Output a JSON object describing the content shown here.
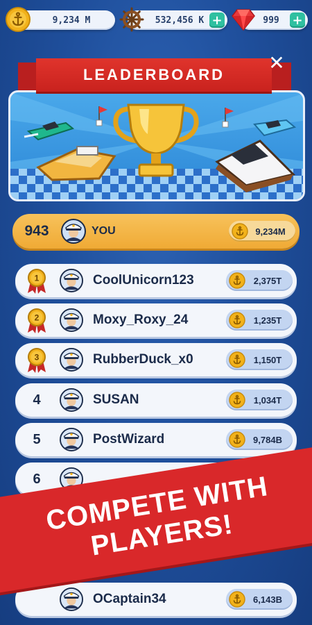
{
  "topbar": {
    "coins": "9,234 M",
    "helm": "532,456 K",
    "gems": "999"
  },
  "banner": {
    "title": "LEADERBOARD"
  },
  "you_row": {
    "rank": "943",
    "name": "YOU",
    "score": "9,234M"
  },
  "rows": [
    {
      "rank": "1",
      "name": "CoolUnicorn123",
      "score": "2,375T",
      "medal": true
    },
    {
      "rank": "2",
      "name": "Moxy_Roxy_24",
      "score": "1,235T",
      "medal": true
    },
    {
      "rank": "3",
      "name": "RubberDuck_x0",
      "score": "1,150T",
      "medal": true
    },
    {
      "rank": "4",
      "name": "SUSAN",
      "score": "1,034T",
      "medal": false
    },
    {
      "rank": "5",
      "name": "PostWizard",
      "score": "9,784B",
      "medal": false
    },
    {
      "rank": "6",
      "name": "",
      "score": "",
      "medal": false
    },
    {
      "rank": "",
      "name": "OCaptain34",
      "score": "6,143B",
      "medal": false
    }
  ],
  "promo": {
    "line1": "COMPETE WITH",
    "line2": "PLAYERS!"
  },
  "colors": {
    "background": "#1f4f9c",
    "you_row": "#f0aa35",
    "ribbon": "#d9282a",
    "plus": "#2fc0a0"
  },
  "icons": [
    "anchor-coin-icon",
    "ship-wheel-icon",
    "gem-icon",
    "plus-icon",
    "close-icon",
    "trophy-icon",
    "medal-icon",
    "captain-avatar-icon"
  ]
}
